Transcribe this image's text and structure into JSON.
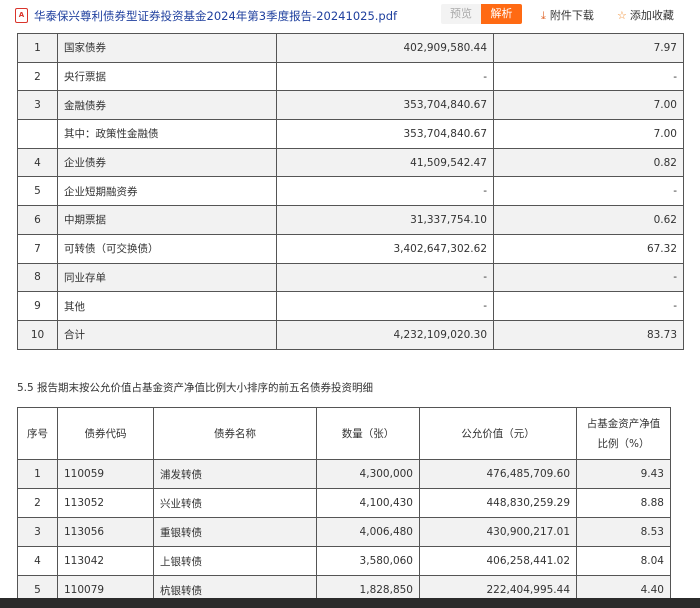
{
  "header": {
    "title": "华泰保兴尊利债券型证券投资基金2024年第3季度报告-20241025.pdf",
    "preview": "预览",
    "parse": "解析",
    "download": "附件下载",
    "favorite": "添加收藏"
  },
  "table1": {
    "rows": [
      [
        "1",
        "国家债券",
        "402,909,580.44",
        "7.97"
      ],
      [
        "2",
        "央行票据",
        "-",
        "-"
      ],
      [
        "3",
        "金融债券",
        "353,704,840.67",
        "7.00"
      ],
      [
        "",
        "其中：政策性金融债",
        "353,704,840.67",
        "7.00"
      ],
      [
        "4",
        "企业债券",
        "41,509,542.47",
        "0.82"
      ],
      [
        "5",
        "企业短期融资券",
        "-",
        "-"
      ],
      [
        "6",
        "中期票据",
        "31,337,754.10",
        "0.62"
      ],
      [
        "7",
        "可转债（可交换债）",
        "3,402,647,302.62",
        "67.32"
      ],
      [
        "8",
        "同业存单",
        "-",
        "-"
      ],
      [
        "9",
        "其他",
        "-",
        "-"
      ],
      [
        "10",
        "合计",
        "4,232,109,020.30",
        "83.73"
      ]
    ]
  },
  "section_title": "5.5 报告期末按公允价值占基金资产净值比例大小排序的前五名债券投资明细",
  "table2": {
    "headers": [
      "序号",
      "债券代码",
      "债券名称",
      "数量（张）",
      "公允价值（元）",
      "占基金资产净值比例（%）"
    ],
    "rows": [
      [
        "1",
        "110059",
        "浦发转债",
        "4,300,000",
        "476,485,709.60",
        "9.43"
      ],
      [
        "2",
        "113052",
        "兴业转债",
        "4,100,430",
        "448,830,259.29",
        "8.88"
      ],
      [
        "3",
        "113056",
        "重银转债",
        "4,006,480",
        "430,900,217.01",
        "8.53"
      ],
      [
        "4",
        "113042",
        "上银转债",
        "3,580,060",
        "406,258,441.02",
        "8.04"
      ],
      [
        "5",
        "110079",
        "杭银转债",
        "1,828,850",
        "222,404,995.44",
        "4.40"
      ]
    ]
  }
}
